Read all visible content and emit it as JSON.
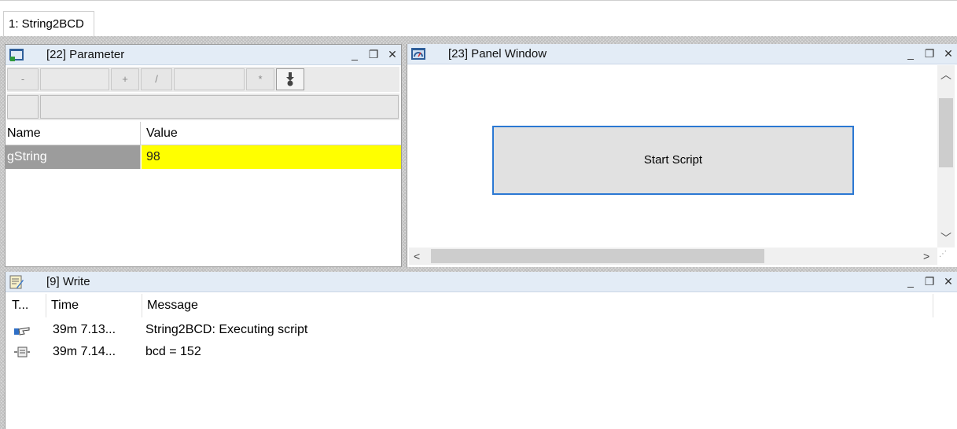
{
  "document_tab": {
    "label": "1: String2BCD"
  },
  "parameter": {
    "title": "[22] Parameter",
    "toolbar": {
      "minus": "-",
      "plus": "+",
      "slash": "/",
      "star": "*"
    },
    "columns": {
      "name": "Name",
      "value": "Value"
    },
    "rows": [
      {
        "name": "gString",
        "value": "98"
      }
    ]
  },
  "panel_window": {
    "title": "[23] Panel Window",
    "start_button": "Start Script"
  },
  "write": {
    "title": "[9] Write",
    "columns": {
      "type": "T...",
      "time": "Time",
      "message": "Message"
    },
    "rows": [
      {
        "icon": "pointing-hand-icon",
        "time": "39m 7.13...",
        "message": "String2BCD: Executing script"
      },
      {
        "icon": "log-output-icon",
        "time": "39m 7.14...",
        "message": "bcd = 152"
      }
    ]
  },
  "window_controls": {
    "minimize": "_",
    "restore": "❐",
    "close": "✕"
  },
  "colors": {
    "selected_value_bg": "#ffff00",
    "selected_name_bg": "#9c9c9c",
    "button_border": "#2b78d3",
    "titlebar_bg": "#e3ecf6"
  }
}
